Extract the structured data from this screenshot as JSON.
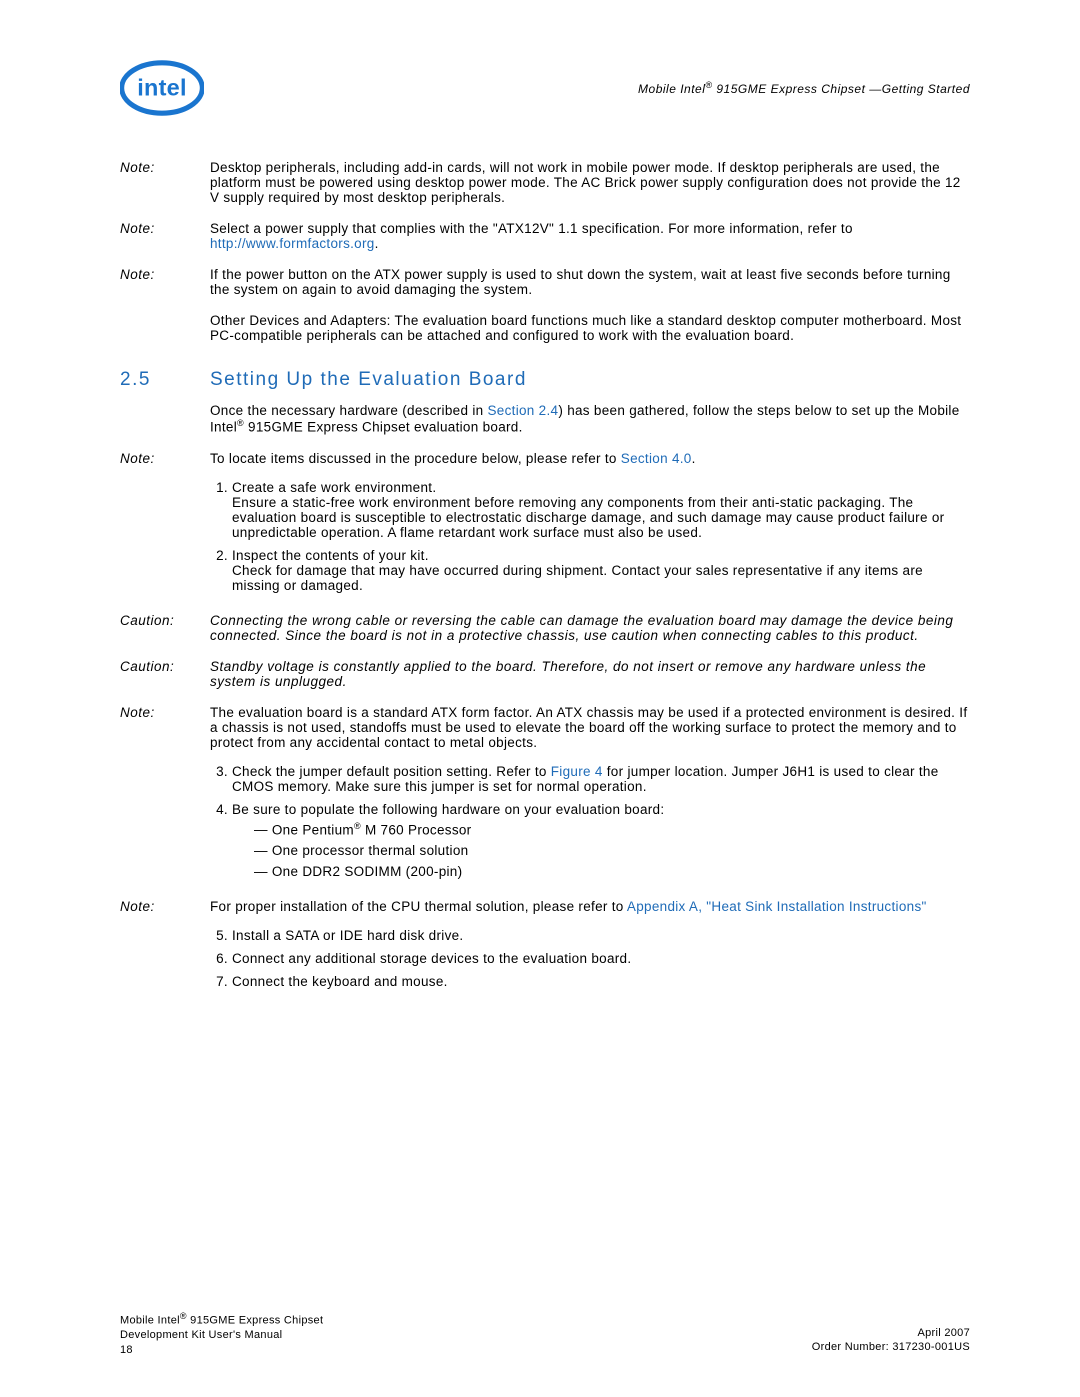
{
  "header": {
    "right_a": "Mobile Intel",
    "right_sup": "®",
    "right_b": " 915GME Express Chipset —Getting Started"
  },
  "blocks": [
    {
      "label": "Note:",
      "text": "Desktop peripherals, including add-in cards, will not work in mobile power mode. If desktop peripherals are used, the platform must be powered using desktop power mode. The AC Brick power supply configuration does not provide the 12 V supply required by most desktop peripherals."
    },
    {
      "label": "Note:",
      "text_a": "Select a power supply that complies with the \"ATX12V\" 1.1 specification. For more information, refer to ",
      "link": "http://www.formfactors.org",
      "text_b": "."
    },
    {
      "label": "Note:",
      "text": "If the power button on the ATX power supply is used to shut down the system, wait at least five seconds before turning the system on again to avoid damaging the system."
    },
    {
      "label": "",
      "text": "Other Devices and Adapters: The evaluation board functions much like a standard desktop computer motherboard. Most PC-compatible peripherals can be attached and configured to work with the evaluation board."
    }
  ],
  "section": {
    "num": "2.5",
    "title": "Setting Up the Evaluation Board"
  },
  "intro": {
    "a": "Once the necessary hardware (described in ",
    "link": "Section 2.4",
    "b": ") has been gathered, follow the steps below to set up the Mobile Intel",
    "sup": "®",
    "c": " 915GME Express Chipset  evaluation board."
  },
  "note_locate": {
    "label": "Note:",
    "a": "To locate items discussed in the procedure below, please refer to ",
    "link": "Section 4.0",
    "b": "."
  },
  "steps_a": [
    {
      "title": "Create a safe work environment.",
      "body": "Ensure a static-free work environment before removing any components from their anti-static packaging. The evaluation board is susceptible to electrostatic discharge damage, and such damage may cause product failure or unpredictable operation. A flame retardant work surface must also be used."
    },
    {
      "title": "Inspect the contents of your kit.",
      "body": "Check for damage that may have occurred during shipment. Contact your sales representative if any items are missing or damaged."
    }
  ],
  "caution1": {
    "label": "Caution:",
    "text": "Connecting the wrong cable or reversing the cable can damage the evaluation board may damage the device being connected. Since the board is not in a protective chassis, use caution when connecting cables to this product."
  },
  "caution2": {
    "label": "Caution:",
    "text": "Standby voltage is constantly applied to the board. Therefore, do not insert or remove any hardware unless the system is unplugged."
  },
  "note_chassis": {
    "label": "Note:",
    "text": "The evaluation board is a standard ATX form factor. An ATX chassis may be used if a protected environment is desired. If a chassis is not used, standoffs must be used to elevate the board off the working surface to protect the memory and to protect from any accidental contact to metal objects."
  },
  "step3": {
    "a": "Check the jumper default position setting. Refer to ",
    "link": "Figure 4",
    "b": " for jumper location. Jumper J6H1 is used to clear the CMOS memory. Make sure this jumper is set for normal operation."
  },
  "step4": {
    "lead": "Be sure to populate the following hardware on your evaluation board:",
    "items_a": "One Pentium",
    "items_a_sup": "®",
    "items_a2": " M 760 Processor",
    "items_b": "One processor thermal solution",
    "items_c": "One DDR2 SODIMM (200-pin)"
  },
  "note_thermal": {
    "label": "Note:",
    "a": "For proper installation of the CPU thermal solution, please refer to ",
    "link": "Appendix A, \"Heat Sink Installation Instructions\""
  },
  "steps_b": [
    "Install a SATA or IDE hard disk drive.",
    "Connect any additional storage devices to the evaluation board.",
    "Connect the keyboard and mouse."
  ],
  "footer": {
    "left_a": "Mobile Intel",
    "left_sup": "®",
    "left_b": " 915GME Express Chipset",
    "left2": "Development Kit User's Manual",
    "left3": "18",
    "right1": "April 2007",
    "right2": "Order Number: 317230-001US"
  }
}
